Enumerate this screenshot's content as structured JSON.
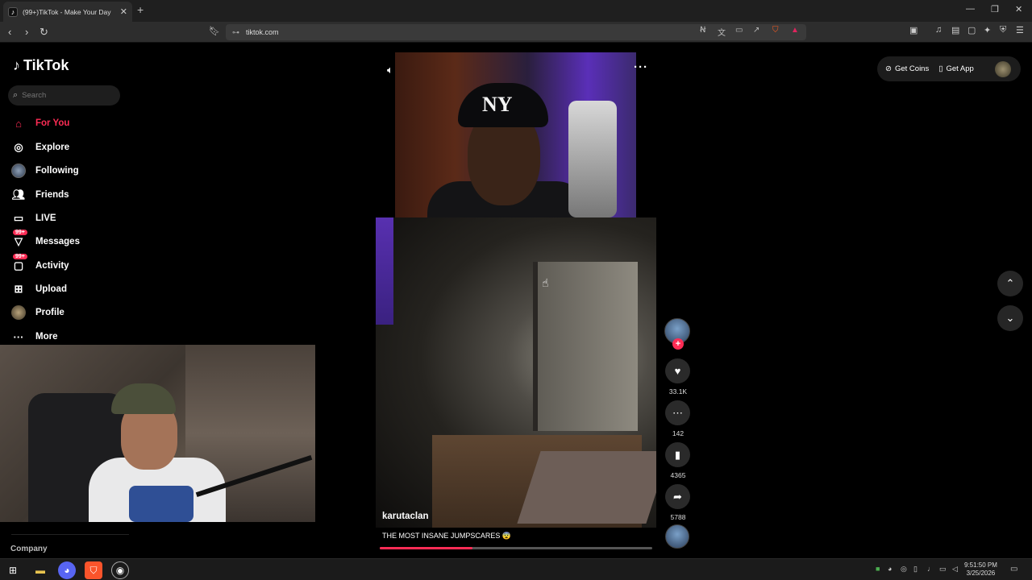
{
  "browser": {
    "tab_title": "(99+)TikTok - Make Your Day",
    "url": "tiktok.com",
    "new_tab": "+",
    "controls": {
      "minimize": "—",
      "restore": "❐",
      "close": "✕"
    }
  },
  "sidebar": {
    "logo_text": "TikTok",
    "search_placeholder": "Search",
    "items": [
      {
        "label": "For You",
        "icon": "home-icon",
        "active": true
      },
      {
        "label": "Explore",
        "icon": "compass-icon"
      },
      {
        "label": "Following",
        "icon": "following-avatar-icon"
      },
      {
        "label": "Friends",
        "icon": "friends-icon"
      },
      {
        "label": "LIVE",
        "icon": "live-tv-icon"
      },
      {
        "label": "Messages",
        "icon": "messages-icon",
        "badge": "99+"
      },
      {
        "label": "Activity",
        "icon": "activity-icon",
        "badge": "99+"
      },
      {
        "label": "Upload",
        "icon": "upload-icon"
      },
      {
        "label": "Profile",
        "icon": "profile-avatar-icon"
      },
      {
        "label": "More",
        "icon": "more-dots-icon"
      }
    ],
    "company_label": "Company"
  },
  "video": {
    "author": "karutaclan",
    "caption": "THE MOST INSANE JUMPSCARES 😨",
    "progress": 0.34,
    "cap_logo": "NY"
  },
  "actions": {
    "likes": "33.1K",
    "comments": "142",
    "saves": "4365",
    "shares": "5788"
  },
  "header": {
    "get_coins": "Get Coins",
    "get_app": "Get App"
  },
  "taskbar": {
    "time": "9:51:50 PM",
    "date": "3/25/2026"
  },
  "colors": {
    "accent": "#fe2c55",
    "background": "#000000"
  }
}
